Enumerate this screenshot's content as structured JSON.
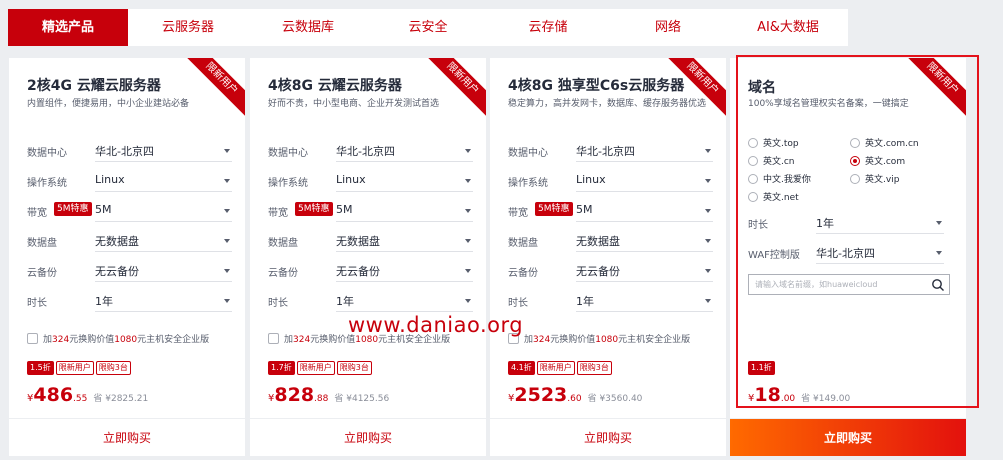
{
  "tabs": [
    {
      "label": "精选产品",
      "active": true
    },
    {
      "label": "云服务器"
    },
    {
      "label": "云数据库"
    },
    {
      "label": "云安全"
    },
    {
      "label": "云存储"
    },
    {
      "label": "网络"
    },
    {
      "label": "AI&大数据"
    }
  ],
  "ribbon_label": "限新用户",
  "badge_5m": "5M特惠",
  "buy_label": "立即购买",
  "cards": [
    {
      "title": "2核4G 云耀云服务器",
      "subtitle": "内置组件，便捷易用，中小企业建站必备",
      "rows": [
        {
          "label": "数据中心",
          "value": "华北-北京四"
        },
        {
          "label": "操作系统",
          "value": "Linux"
        },
        {
          "label": "带宽",
          "value": "5M"
        },
        {
          "label": "数据盘",
          "value": "无数据盘"
        },
        {
          "label": "云备份",
          "value": "无云备份"
        },
        {
          "label": "时长",
          "value": "1年"
        }
      ],
      "promo": {
        "pre": "加",
        "amt1": "324",
        "mid": "元换购价值",
        "amt2": "1080",
        "post": "元主机安全企业版"
      },
      "tags": [
        "1.5折",
        "限新用户",
        "限购3台"
      ],
      "price": {
        "currency": "¥",
        "int": "486",
        "dec": ".55",
        "orig": "省 ¥2825.21"
      }
    },
    {
      "title": "4核8G 云耀云服务器",
      "subtitle": "好而不贵，中小型电商、企业开发测试首选",
      "rows": [
        {
          "label": "数据中心",
          "value": "华北-北京四"
        },
        {
          "label": "操作系统",
          "value": "Linux"
        },
        {
          "label": "带宽",
          "value": "5M"
        },
        {
          "label": "数据盘",
          "value": "无数据盘"
        },
        {
          "label": "云备份",
          "value": "无云备份"
        },
        {
          "label": "时长",
          "value": "1年"
        }
      ],
      "promo": {
        "pre": "加",
        "amt1": "324",
        "mid": "元换购价值",
        "amt2": "1080",
        "post": "元主机安全企业版"
      },
      "tags": [
        "1.7折",
        "限新用户",
        "限购3台"
      ],
      "price": {
        "currency": "¥",
        "int": "828",
        "dec": ".88",
        "orig": "省 ¥4125.56"
      }
    },
    {
      "title": "4核8G 独享型C6s云服务器",
      "subtitle": "稳定算力，高并发网卡，数据库、缓存服务器优选",
      "rows": [
        {
          "label": "数据中心",
          "value": "华北-北京四"
        },
        {
          "label": "操作系统",
          "value": "Linux"
        },
        {
          "label": "带宽",
          "value": "5M"
        },
        {
          "label": "数据盘",
          "value": "无数据盘"
        },
        {
          "label": "云备份",
          "value": "无云备份"
        },
        {
          "label": "时长",
          "value": "1年"
        }
      ],
      "promo": {
        "pre": "加",
        "amt1": "324",
        "mid": "元换购价值",
        "amt2": "1080",
        "post": "元主机安全企业版"
      },
      "tags": [
        "4.1折",
        "限新用户",
        "限购3台"
      ],
      "price": {
        "currency": "¥",
        "int": "2523",
        "dec": ".60",
        "orig": "省 ¥3560.40"
      }
    }
  ],
  "domain": {
    "title": "域名",
    "subtitle": "100%享域名管理权实名备案，一键搞定",
    "options": [
      {
        "label": "英文.top",
        "selected": false
      },
      {
        "label": "英文.com.cn",
        "selected": false
      },
      {
        "label": "英文.cn",
        "selected": false
      },
      {
        "label": "英文.com",
        "selected": true
      },
      {
        "label": "中文.我爱你",
        "selected": false
      },
      {
        "label": "英文.vip",
        "selected": false
      },
      {
        "label": "英文.net",
        "selected": false
      }
    ],
    "rows": [
      {
        "label": "时长",
        "value": "1年"
      },
      {
        "label": "WAF控制版",
        "value": "华北-北京四"
      }
    ],
    "search_placeholder": "请输入域名前缀，如huaweicloud",
    "tags": [
      "1.1折"
    ],
    "price": {
      "currency": "¥",
      "int": "18",
      "dec": ".00",
      "orig": "省 ¥149.00"
    }
  },
  "watermark": "www.daniao.org",
  "colors": {
    "brand": "#c7000b",
    "buy_gradient_start": "#ff6a00",
    "buy_gradient_end": "#e3110d",
    "highlight": "#e4121b"
  }
}
